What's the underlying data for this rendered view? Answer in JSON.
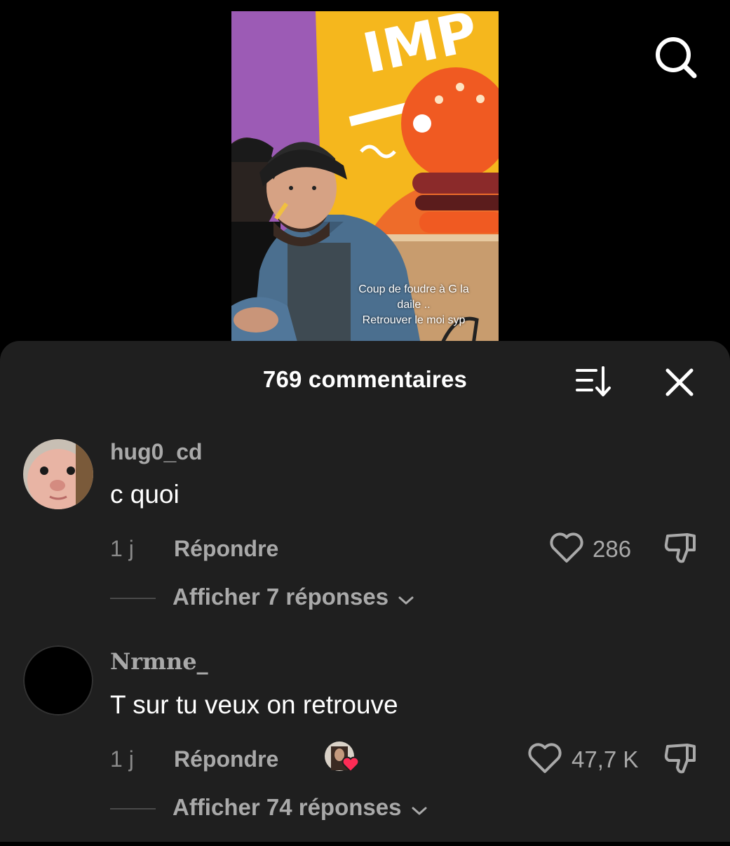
{
  "video": {
    "sign_text": "IMP",
    "caption_lines": [
      "Coup de foudre à G la",
      "daile ..",
      "Retrouver le moi syp"
    ]
  },
  "icons": {
    "search": "search-icon",
    "sort": "sort-icon",
    "close": "close-icon",
    "like": "heart-outline-icon",
    "dislike": "thumbs-down-icon",
    "chevron": "chevron-down-icon"
  },
  "colors": {
    "sheet_bg": "#1f1f1f",
    "muted_text": "#a9a9a9",
    "creator_heart": "#fe2c55"
  },
  "sheet": {
    "title": "769 commentaires"
  },
  "comments": [
    {
      "username": "hug0_cd",
      "text": "c quoi",
      "time": "1 j",
      "reply_label": "Répondre",
      "likes": "286",
      "replies_label": "Afficher 7 réponses",
      "creator_liked": false
    },
    {
      "username": "Nrmne_",
      "text": "T sur tu veux on retrouve",
      "time": "1 j",
      "reply_label": "Répondre",
      "likes": "47,7 K",
      "replies_label": "Afficher 74 réponses",
      "creator_liked": true
    }
  ]
}
